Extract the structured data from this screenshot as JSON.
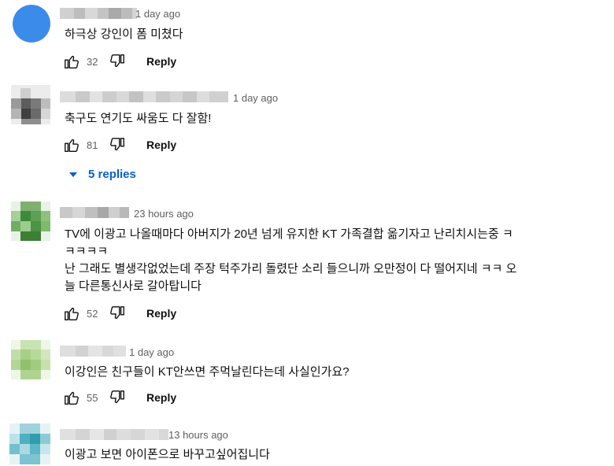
{
  "comments": [
    {
      "time": "1 day ago",
      "text": "하극상 강인이 폼 미쳤다",
      "likes": "32",
      "reply": "Reply"
    },
    {
      "time": "1 day ago",
      "text": "축구도 연기도 싸움도 다 잘함!",
      "likes": "81",
      "reply": "Reply",
      "replies": "5 replies"
    },
    {
      "time": "23 hours ago",
      "text_lines": [
        "TV에 이광고 나올때마다 아버지가 20년 넘게 유지한 KT 가족결합 옮기자고 난리치시는중 ㅋ",
        "ㅋㅋㅋㅋ",
        "난 그래도 별생각없었는데 주장 턱주가리 돌렸단 소리 들으니까 오만정이 다 떨어지네 ㅋㅋ 오",
        "늘 다른통신사로 갈아탑니다"
      ],
      "likes": "52",
      "reply": "Reply"
    },
    {
      "time": "1 day ago",
      "text": "이강인은 친구들이 KT안쓰면 주먹날린다는데 사실인가요?",
      "likes": "55",
      "reply": "Reply"
    },
    {
      "time": "13 hours ago",
      "text": "이광고 보면 아이폰으로 바꾸고싶어집니다"
    }
  ],
  "colors": {
    "link": "#065fd4",
    "avatar1": "#3b8beb",
    "meta": "#606060"
  }
}
